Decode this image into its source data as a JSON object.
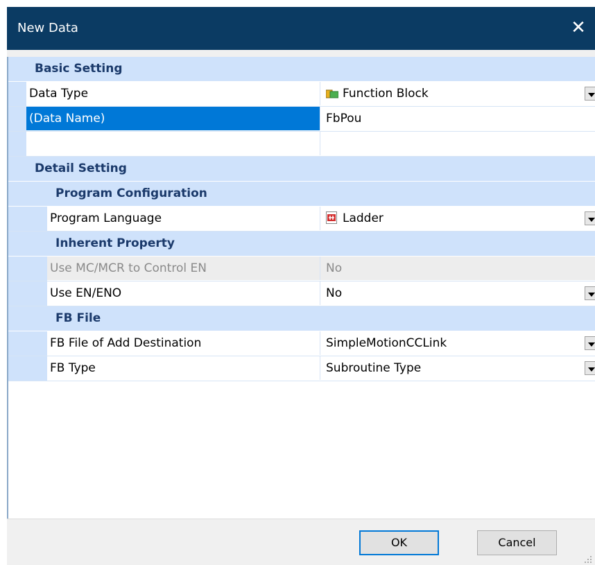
{
  "window": {
    "title": "New Data"
  },
  "sections": {
    "basic": {
      "label": "Basic Setting"
    },
    "detail": {
      "label": "Detail Setting"
    },
    "program_config": {
      "label": "Program Configuration"
    },
    "inherent": {
      "label": "Inherent Property"
    },
    "fb_file": {
      "label": "FB File"
    }
  },
  "props": {
    "data_type": {
      "label": "Data Type",
      "value": "Function Block",
      "icon": "function-block-icon"
    },
    "data_name": {
      "label": "(Data Name)",
      "value": "FbPou"
    },
    "program_language": {
      "label": "Program Language",
      "value": "Ladder",
      "icon": "ladder-icon"
    },
    "use_mc_mcr": {
      "label": "Use MC/MCR to Control EN",
      "value": "No"
    },
    "use_en_eno": {
      "label": "Use EN/ENO",
      "value": "No"
    },
    "fb_file_dest": {
      "label": "FB File of Add Destination",
      "value": "SimpleMotionCCLink"
    },
    "fb_type": {
      "label": "FB Type",
      "value": "Subroutine Type"
    }
  },
  "buttons": {
    "ok": "OK",
    "cancel": "Cancel"
  },
  "colors": {
    "titlebar": "#0b3b63",
    "category": "#cfe2fb",
    "selected": "#0078d7"
  }
}
